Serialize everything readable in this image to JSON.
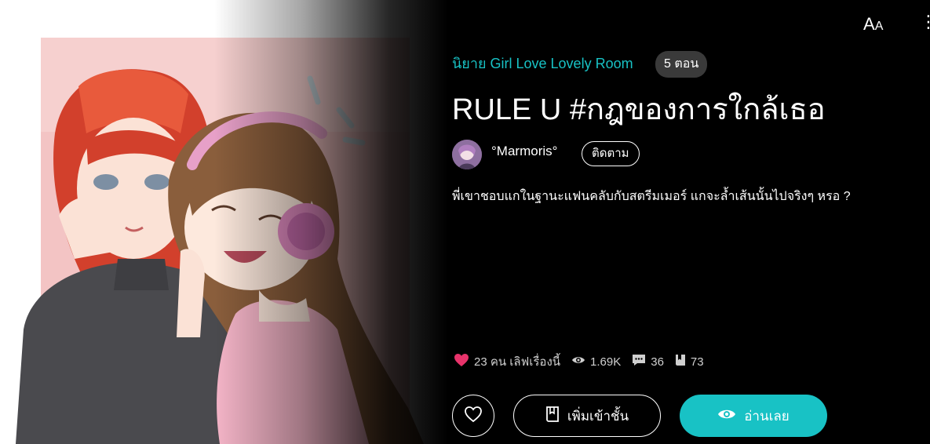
{
  "header": {
    "font_size_label_large": "A",
    "font_size_label_small": "A",
    "more_label": "⋮"
  },
  "novel": {
    "category": "นิยาย Girl Love Lovely Room",
    "episodes": "5 ตอน",
    "title": "RULE U #กฎของการใกล้เธอ",
    "author": "°Marmoris°",
    "follow_label": "ติดตาม",
    "synopsis": "พี่เขาชอบแกในฐานะแฟนคลับกับสตรีมเมอร์ แกจะล้ำเส้นนั้นไปจริงๆ หรอ ?"
  },
  "stats": {
    "likes": "23 คน เลิฟเรื่องนี้",
    "views": "1.69K",
    "comments": "36",
    "bookmarks": "73"
  },
  "actions": {
    "add_to_shelf_label": "เพิ่มเข้าชั้น",
    "read_now_label": "อ่านเลย"
  },
  "icons": {
    "heart": "heart-icon",
    "eye": "eye-icon",
    "comment": "comment-icon",
    "book": "book-icon"
  },
  "colors": {
    "accent": "#18c2c5",
    "like": "#e8336b",
    "background": "#000000"
  }
}
